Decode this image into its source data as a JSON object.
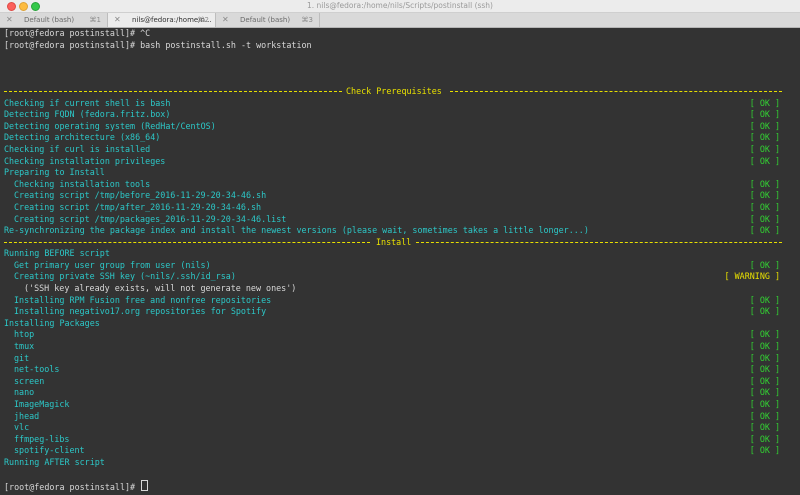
{
  "window": {
    "title": "1. nils@fedora:/home/nils/Scripts/postinstall (ssh)"
  },
  "tabs": [
    {
      "label": "Default (bash)",
      "shortcut": "⌘1"
    },
    {
      "label": "nils@fedora:/home/n...",
      "shortcut": "⌘2"
    },
    {
      "label": "Default (bash)",
      "shortcut": "⌘3"
    }
  ],
  "terminal": {
    "l1": "[root@fedora postinstall]# ^C",
    "l2": "[root@fedora postinstall]# bash postinstall.sh -t workstation",
    "section_prereq": "Check Prerequisites",
    "section_install": "Install",
    "prereq": [
      {
        "text": "Checking if current shell is bash",
        "status": "[ OK ]"
      },
      {
        "text": "Detecting FQDN (fedora.fritz.box)",
        "status": "[ OK ]"
      },
      {
        "text": "Detecting operating system (RedHat/CentOS)",
        "status": "[ OK ]"
      },
      {
        "text": "Detecting architecture (x86_64)",
        "status": "[ OK ]"
      },
      {
        "text": "Checking if curl is installed",
        "status": "[ OK ]"
      },
      {
        "text": "Checking installation privileges",
        "status": "[ OK ]"
      }
    ],
    "preparing": "Preparing to Install",
    "prep_items": [
      {
        "text": "Checking installation tools",
        "status": "[ OK ]"
      },
      {
        "text": "Creating script /tmp/before_2016-11-29-20-34-46.sh",
        "status": "[ OK ]"
      },
      {
        "text": "Creating script /tmp/after_2016-11-29-20-34-46.sh",
        "status": "[ OK ]"
      },
      {
        "text": "Creating script /tmp/packages_2016-11-29-20-34-46.list",
        "status": "[ OK ]"
      }
    ],
    "resync": {
      "text": "Re-synchronizing the package index and install the newest versions (please wait, sometimes takes a little longer...)",
      "status": "[ OK ]"
    },
    "before": "Running BEFORE script",
    "before_items": [
      {
        "text": "Get primary user group from user (nils)",
        "status": "[ OK ]"
      },
      {
        "text": "Creating private SSH key (~nils/.ssh/id_rsa)",
        "status": "[ WARNING ]"
      }
    ],
    "ssh_note": "('SSH key already exists, will not generate new ones')",
    "before_items2": [
      {
        "text": "Installing RPM Fusion free and nonfree repositories",
        "status": "[ OK ]"
      },
      {
        "text": "Installing negativo17.org repositories for Spotify",
        "status": "[ OK ]"
      }
    ],
    "installing": "Installing Packages",
    "packages": [
      {
        "text": "htop",
        "status": "[ OK ]"
      },
      {
        "text": "tmux",
        "status": "[ OK ]"
      },
      {
        "text": "git",
        "status": "[ OK ]"
      },
      {
        "text": "net-tools",
        "status": "[ OK ]"
      },
      {
        "text": "screen",
        "status": "[ OK ]"
      },
      {
        "text": "nano",
        "status": "[ OK ]"
      },
      {
        "text": "ImageMagick",
        "status": "[ OK ]"
      },
      {
        "text": "jhead",
        "status": "[ OK ]"
      },
      {
        "text": "vlc",
        "status": "[ OK ]"
      },
      {
        "text": "ffmpeg-libs",
        "status": "[ OK ]"
      },
      {
        "text": "spotify-client",
        "status": "[ OK ]"
      }
    ],
    "after": "Running AFTER script",
    "prompt": "[root@fedora postinstall]# "
  },
  "colors": {
    "background": "#333333",
    "ok": "#33d133",
    "warning": "#e8e000",
    "info": "#2cc8c8",
    "rule": "#e8e000"
  }
}
